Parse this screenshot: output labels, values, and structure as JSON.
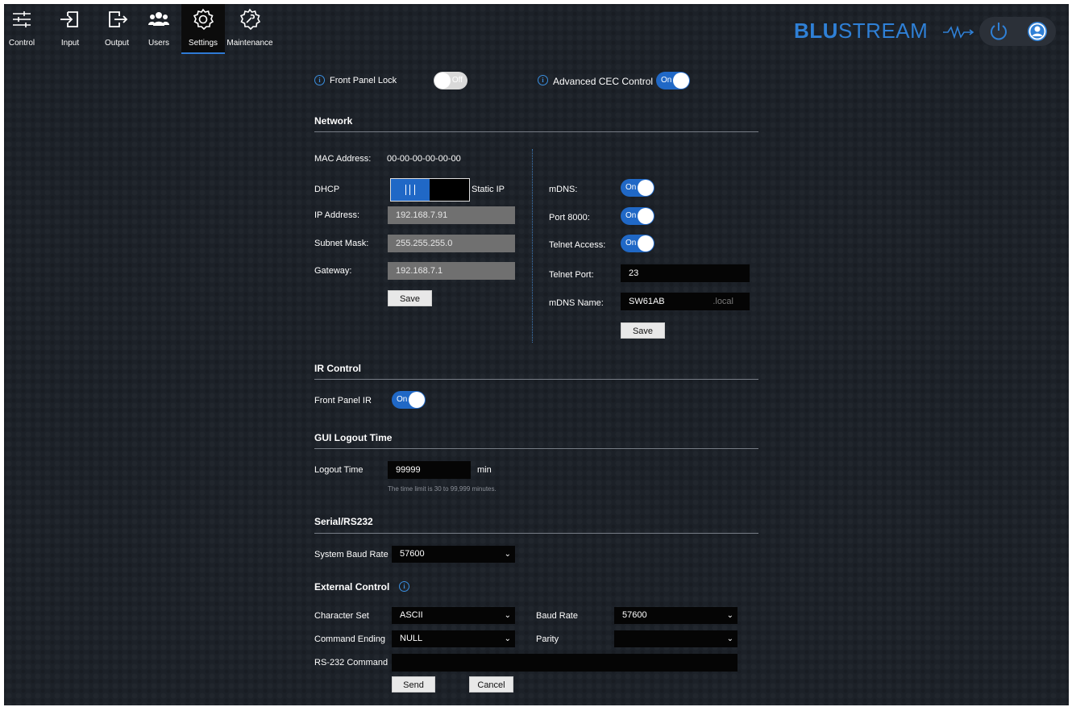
{
  "nav": {
    "items": [
      {
        "label": "Control",
        "icon": "sliders-icon"
      },
      {
        "label": "Input",
        "icon": "input-icon"
      },
      {
        "label": "Output",
        "icon": "output-icon"
      },
      {
        "label": "Users",
        "icon": "users-icon"
      },
      {
        "label": "Settings",
        "icon": "gear-icon",
        "active": true
      },
      {
        "label": "Maintenance",
        "icon": "wrench-gear-icon"
      }
    ]
  },
  "header": {
    "logo_bold": "BLU",
    "logo_thin": "STREAM",
    "power_icon": "power-icon",
    "user_icon": "user-icon",
    "accent": "#2f80d6"
  },
  "top_toggles": {
    "front_panel_lock": {
      "label": "Front Panel Lock",
      "state": "Off"
    },
    "advanced_cec": {
      "label": "Advanced CEC Control",
      "state": "On"
    }
  },
  "network": {
    "title": "Network",
    "mac_label": "MAC Address:",
    "mac_value": "00-00-00-00-00-00",
    "dhcp_label": "DHCP",
    "static_label": "Static IP",
    "ip_label": "IP Address:",
    "ip_value": "192.168.7.91",
    "subnet_label": "Subnet Mask:",
    "subnet_value": "255.255.255.0",
    "gateway_label": "Gateway:",
    "gateway_value": "192.168.7.1",
    "save_label": "Save",
    "mdns_label": "mDNS:",
    "mdns_state": "On",
    "port8000_label": "Port 8000:",
    "port8000_state": "On",
    "telnet_access_label": "Telnet Access:",
    "telnet_access_state": "On",
    "telnet_port_label": "Telnet Port:",
    "telnet_port_value": "23",
    "mdns_name_label": "mDNS Name:",
    "mdns_name_value": "SW61AB",
    "mdns_suffix": ".local",
    "save2_label": "Save"
  },
  "ir": {
    "title": "IR Control",
    "front_panel_ir_label": "Front Panel IR",
    "front_panel_ir_state": "On"
  },
  "logout": {
    "title": "GUI Logout Time",
    "label": "Logout Time",
    "value": "99999",
    "unit": "min",
    "hint": "The time limit is 30 to 99,999 minutes."
  },
  "serial": {
    "title": "Serial/RS232",
    "baud_label": "System Baud Rate",
    "baud_value": "57600"
  },
  "external": {
    "title": "External Control",
    "charset_label": "Character Set",
    "charset_value": "ASCII",
    "baud_label": "Baud Rate",
    "baud_value": "57600",
    "ending_label": "Command Ending",
    "ending_value": "NULL",
    "parity_label": "Parity",
    "parity_value": "",
    "rs232_label": "RS-232 Command",
    "rs232_value": "",
    "send_label": "Send",
    "cancel_label": "Cancel"
  }
}
